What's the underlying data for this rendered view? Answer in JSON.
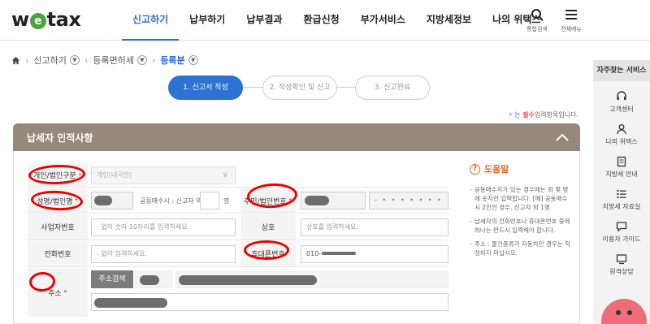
{
  "brand": {
    "logo_pre": "w",
    "logo_o": "e",
    "logo_post": "tax"
  },
  "nav": [
    "신고하기",
    "납부하기",
    "납부결과",
    "환급신청",
    "부가서비스",
    "지방세정보",
    "나의 위택스"
  ],
  "header_buttons": {
    "search": "통합검색",
    "menu": "전체메뉴"
  },
  "breadcrumb": {
    "items": [
      "신고하기",
      "등록면허세",
      "등록분"
    ]
  },
  "steps": [
    "1. 신고서 작성",
    "2. 작성확인 및 신고",
    "3. 신고완료"
  ],
  "required_note": {
    "mark": "•",
    "text1": "는 ",
    "bold": "필수",
    "text2": "입력항목입니다."
  },
  "section": {
    "title": "납세자 인적사항"
  },
  "form": {
    "type_label": "개인/법인구분",
    "type_value": "개인(내국인)",
    "name_label": "성명/법인명",
    "co_owner_label": "공동매수시 : 신고자 외",
    "co_owner_unit": "명",
    "id_label": "주민/법인번호",
    "id_suffix": "- • • • • • • •",
    "biz_label": "사업자번호",
    "biz_placeholder": "- 없이 숫자 10자리를 입력하세요.",
    "trade_label": "상호",
    "trade_placeholder": "상호를 입력하세요.",
    "phone_label": "전화번호",
    "phone_placeholder": "- 없이 입력하세요.",
    "mobile_label": "휴대폰번호",
    "mobile_value": "010-",
    "addr_label": "주소",
    "addr_button": "주소검색"
  },
  "help": {
    "title": "도움말",
    "items": [
      "공동매수자가 있는 경우에는 외 몇 명에 숫자만 입력합니다. [예] 공동매수시 2인인 경우, 신고자 외 1명",
      "납세자의 전화번호나 휴대폰번호 중에 하나는 반드시 입력해야 합니다.",
      "주소 : 물건중류가 자동차인 경우는 작성하지 마십시오."
    ]
  },
  "side": {
    "title": "자주찾는 서비스",
    "items": [
      "고객센터",
      "나의 위택스",
      "지방세 안내",
      "지방세 자료실",
      "이용자 가이드",
      "원격상담"
    ]
  }
}
